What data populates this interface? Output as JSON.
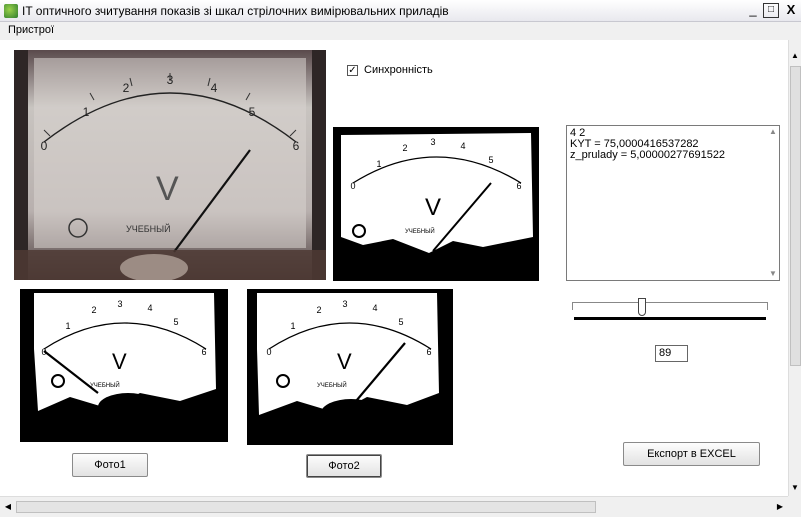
{
  "window": {
    "title": "IT оптичного зчитування показів зі шкал стрілочних вимірювальних приладів",
    "minimize": "_",
    "maximize": "□",
    "close": "X"
  },
  "menu": {
    "items": [
      "Пристрої"
    ]
  },
  "camera": {
    "scale_labels": [
      "0",
      "1",
      "2",
      "3",
      "4",
      "5",
      "6"
    ],
    "unit": "V",
    "brand": "УЧЕБНЫЙ",
    "needle_value": 5.0
  },
  "sync": {
    "label": "Синхронність",
    "checked": true
  },
  "memo": {
    "lines": [
      "4  2",
      "KYT = 75,0000416537282",
      "z_prulady = 5,00000277691522"
    ]
  },
  "slider": {
    "value": 89,
    "min": 0,
    "max": 255,
    "fraction": 0.35
  },
  "buttons": {
    "photo1": "Фото1",
    "photo2": "Фото2",
    "export": "Експорт в EXCEL"
  },
  "icons": {
    "app": "app-icon",
    "scroll_up": "arrow-up-icon",
    "scroll_down": "arrow-down-icon",
    "scroll_left": "arrow-left-icon",
    "scroll_right": "arrow-right-icon"
  }
}
